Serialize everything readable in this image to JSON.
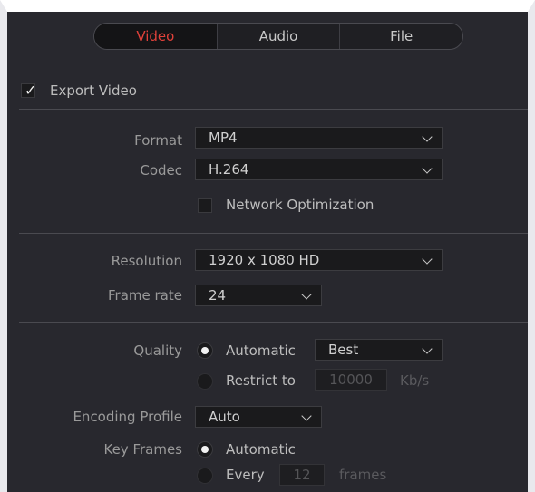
{
  "tabs": [
    {
      "label": "Video",
      "active": true
    },
    {
      "label": "Audio",
      "active": false
    },
    {
      "label": "File",
      "active": false
    }
  ],
  "export_video": {
    "label": "Export Video",
    "checked": true
  },
  "format": {
    "label": "Format",
    "value": "MP4"
  },
  "codec": {
    "label": "Codec",
    "value": "H.264"
  },
  "network_optimization": {
    "label": "Network Optimization",
    "checked": false
  },
  "resolution": {
    "label": "Resolution",
    "value": "1920 x 1080 HD"
  },
  "frame_rate": {
    "label": "Frame rate",
    "value": "24"
  },
  "quality": {
    "label": "Quality",
    "automatic_label": "Automatic",
    "automatic_selected": true,
    "automatic_value": "Best",
    "restrict_label": "Restrict to",
    "restrict_value": "10000",
    "restrict_unit": "Kb/s"
  },
  "encoding_profile": {
    "label": "Encoding Profile",
    "value": "Auto"
  },
  "key_frames": {
    "label": "Key Frames",
    "automatic_label": "Automatic",
    "automatic_selected": true,
    "every_label": "Every",
    "every_value": "12",
    "every_unit": "frames"
  },
  "colors": {
    "accent": "#e0413a",
    "background": "#28282e",
    "field": "#1a1a1c"
  }
}
